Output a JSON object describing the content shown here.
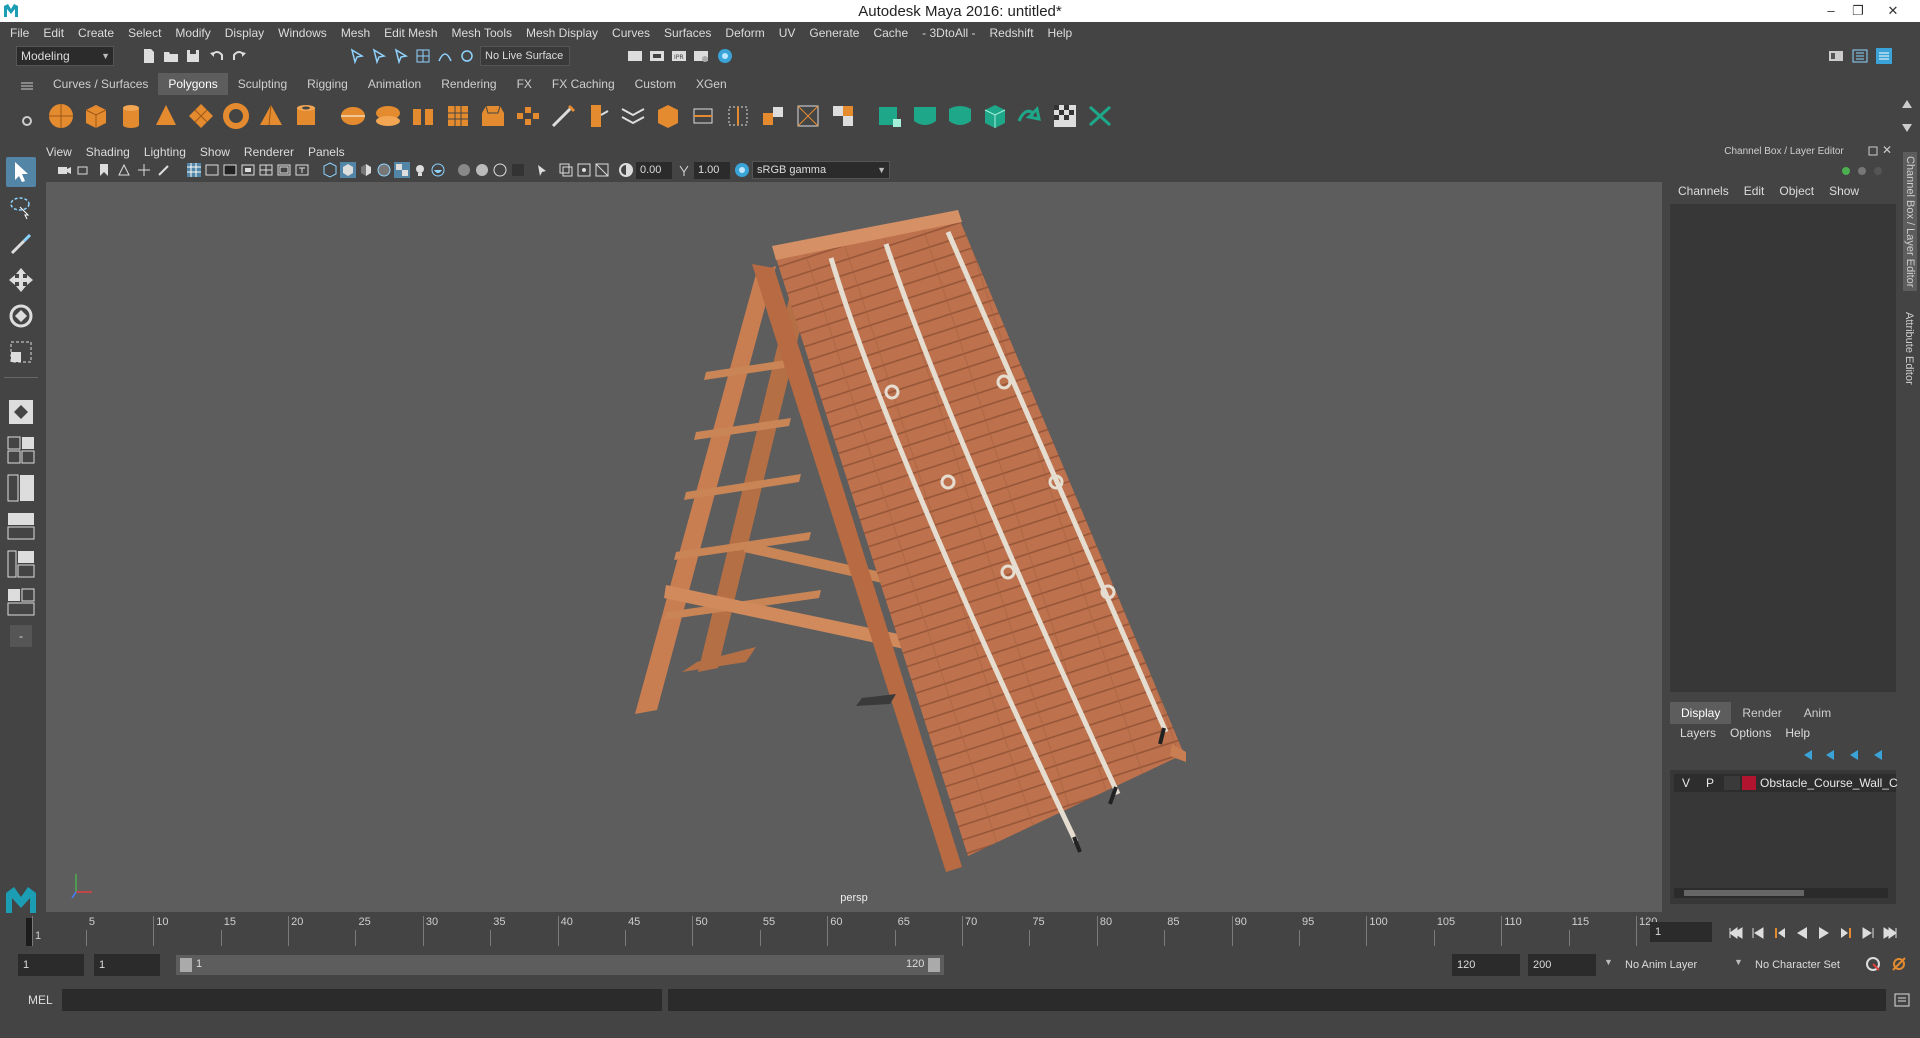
{
  "window": {
    "title": "Autodesk Maya 2016: untitled*",
    "controls": [
      "–",
      "❐",
      "✕"
    ]
  },
  "menubar": {
    "items": [
      "File",
      "Edit",
      "Create",
      "Select",
      "Modify",
      "Display",
      "Windows",
      "Mesh",
      "Edit Mesh",
      "Mesh Tools",
      "Mesh Display",
      "Curves",
      "Surfaces",
      "Deform",
      "UV",
      "Generate",
      "Cache",
      "- 3DtoAll -",
      "Redshift",
      "Help"
    ]
  },
  "statusline": {
    "mode": "Modeling",
    "live_surface": "No Live Surface"
  },
  "shelf": {
    "tabs": [
      "Curves / Surfaces",
      "Polygons",
      "Sculpting",
      "Rigging",
      "Animation",
      "Rendering",
      "FX",
      "FX Caching",
      "Custom",
      "XGen"
    ],
    "active_tab": "Polygons"
  },
  "viewport": {
    "menu": [
      "View",
      "Shading",
      "Lighting",
      "Show",
      "Renderer",
      "Panels"
    ],
    "exposure": "0.00",
    "gamma": "1.00",
    "color_space": "sRGB gamma",
    "camera_label": "persp"
  },
  "channel_box": {
    "title": "Channel Box / Layer Editor",
    "menu": [
      "Channels",
      "Edit",
      "Object",
      "Show"
    ]
  },
  "layer_editor": {
    "tabs": [
      "Display",
      "Render",
      "Anim"
    ],
    "active_tab": "Display",
    "menu": [
      "Layers",
      "Options",
      "Help"
    ],
    "layers": [
      {
        "v": "V",
        "p": "P",
        "name": "Obstacle_Course_Wall_C",
        "color": "#b0142e"
      }
    ]
  },
  "side_tabs": [
    "Channel Box / Layer Editor",
    "Attribute Editor"
  ],
  "timeslider": {
    "labels": [
      "1",
      "5",
      "10",
      "15",
      "20",
      "25",
      "30",
      "35",
      "40",
      "45",
      "50",
      "55",
      "60",
      "65",
      "70",
      "75",
      "80",
      "85",
      "90",
      "95",
      "100",
      "105",
      "110",
      "115",
      "120"
    ],
    "current_frame": "1"
  },
  "range": {
    "start": "1",
    "playback_start": "1",
    "slider_start": "1",
    "slider_end": "120",
    "playback_end": "120",
    "end": "200",
    "anim_layer": "No Anim Layer",
    "character_set": "No Character Set"
  },
  "cmdline": {
    "label": "MEL"
  },
  "colors": {
    "accent": "#5285a6",
    "viewport_bg": "#5d5d5d",
    "panel_bg": "#444444"
  }
}
